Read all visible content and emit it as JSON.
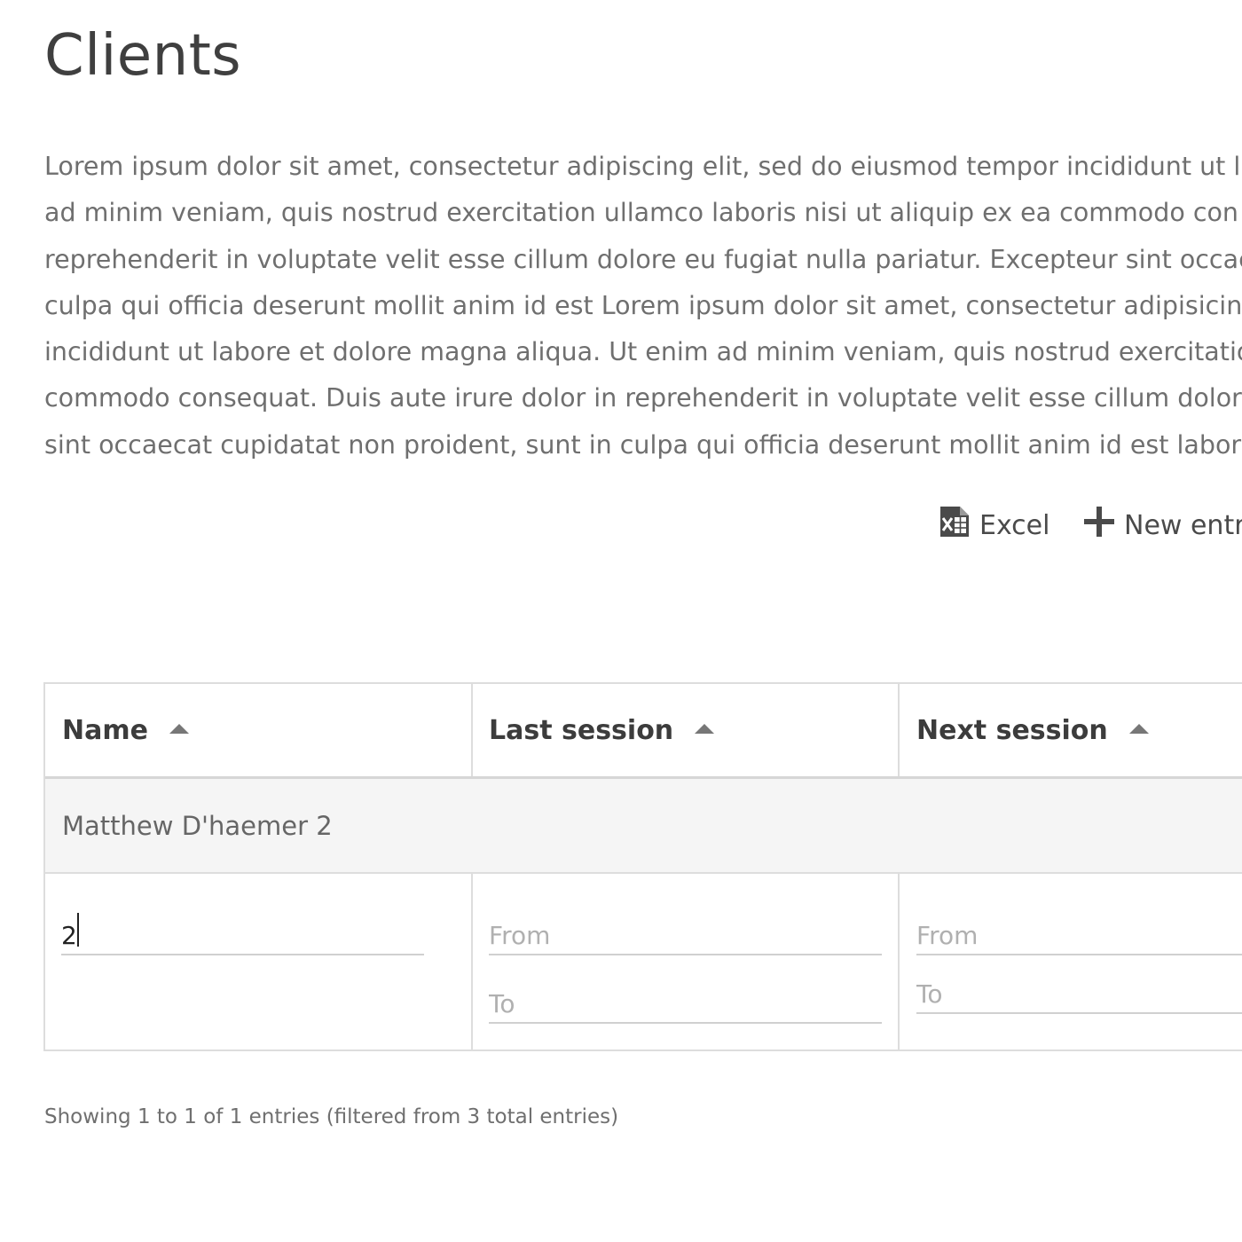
{
  "page": {
    "title": "Clients",
    "intro_lines": [
      "Lorem ipsum dolor sit amet, consectetur adipiscing elit, sed do eiusmod tempor incididunt ut l",
      "ad minim veniam, quis nostrud exercitation ullamco laboris nisi ut aliquip ex ea commodo con",
      "reprehenderit in voluptate velit esse cillum dolore eu fugiat nulla pariatur. Excepteur sint occae",
      "culpa qui officia deserunt mollit anim id est Lorem ipsum dolor sit amet, consectetur adipisicin",
      "incididunt ut labore et dolore magna aliqua. Ut enim ad minim veniam, quis nostrud exercitatio",
      "commodo consequat. Duis aute irure dolor in reprehenderit in voluptate velit esse cillum dolor",
      "sint occaecat cupidatat non proident, sunt in culpa qui officia deserunt mollit anim id est labor"
    ]
  },
  "toolbar": {
    "excel_label": "Excel",
    "excel_icon": "excel-file-icon",
    "new_entry_label": "New entr",
    "new_entry_icon": "plus-icon"
  },
  "table": {
    "columns": [
      {
        "label": "Name",
        "sort": "ascending"
      },
      {
        "label": "Last session",
        "sort": "ascending"
      },
      {
        "label": "Next session",
        "sort": "ascending"
      }
    ],
    "rows": [
      {
        "name": "Matthew D'haemer 2",
        "last_session": "",
        "next_session": ""
      }
    ],
    "filters": {
      "name_value": "2",
      "last_from_placeholder": "From",
      "last_to_placeholder": "To",
      "next_from_placeholder": "From",
      "next_to_placeholder": "To"
    }
  },
  "footer": {
    "info": "Showing 1 to 1 of 1 entries (filtered from 3 total entries)"
  },
  "colors": {
    "text_dark": "#3c3c3c",
    "text_muted": "#6f6f6f",
    "border": "#dddddd",
    "row_background": "#f5f5f5",
    "placeholder": "#b0b0b0"
  }
}
